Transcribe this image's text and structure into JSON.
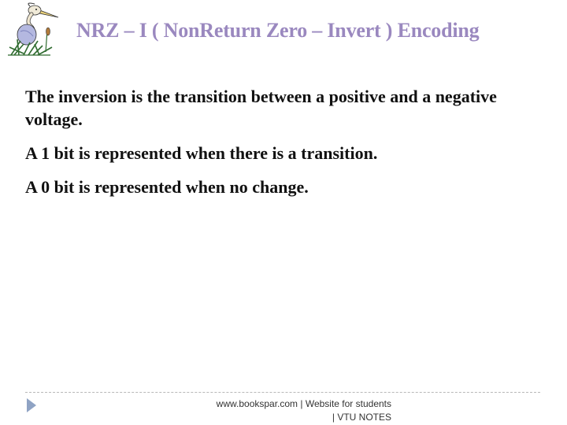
{
  "logo": {
    "icon": "heron-bird-icon"
  },
  "header": {
    "title": "NRZ – I  ( NonReturn Zero – Invert ) Encoding"
  },
  "content": {
    "paragraphs": [
      "The inversion is the transition between a positive and a negative voltage.",
      "A 1 bit is represented when there is a transition.",
      "A 0 bit is represented  when  no change."
    ]
  },
  "footer": {
    "line1": "www.bookspar.com | Website for students",
    "line2": "| VTU NOTES",
    "arrow_icon": "triangle-right-icon"
  },
  "colors": {
    "title": "#9a88bf",
    "text": "#111111",
    "arrow": "#8fa3c4"
  }
}
